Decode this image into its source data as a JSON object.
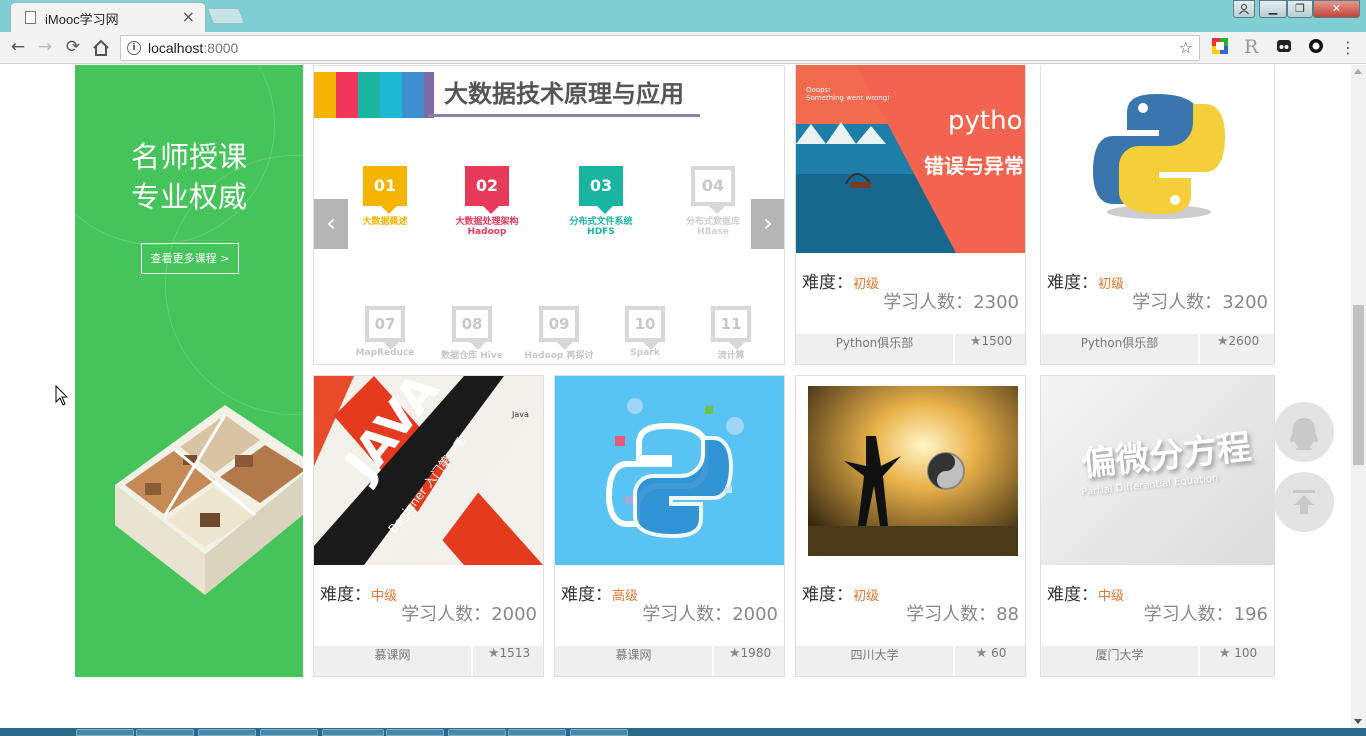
{
  "browser": {
    "tab_title": "iMooc学习网",
    "tab_close": "×",
    "url_host": "localhost",
    "url_port": ":8000",
    "ext_r": "R"
  },
  "promo": {
    "line1": "名师授课",
    "line2": "专业权威",
    "button": "查看更多课程 >"
  },
  "banner": {
    "title": "大数据技术原理与应用",
    "modules": [
      {
        "num": "01",
        "label": "大数据概述",
        "sub": "",
        "color": "#f5b400"
      },
      {
        "num": "02",
        "label": "大数据处理架构",
        "sub": "Hadoop",
        "color": "#e83a5b"
      },
      {
        "num": "03",
        "label": "分布式文件系统",
        "sub": "HDFS",
        "color": "#1ab5a0"
      },
      {
        "num": "04",
        "label": "分布式数据库",
        "sub": "HBase",
        "color": "#d0d0d0"
      }
    ],
    "modules_small": [
      {
        "num": "07",
        "label": "MapReduce"
      },
      {
        "num": "08",
        "label": "数据仓库 Hive"
      },
      {
        "num": "09",
        "label": "Hadoop 再探讨"
      },
      {
        "num": "10",
        "label": "Spark"
      },
      {
        "num": "11",
        "label": "流计算"
      }
    ],
    "prev": "‹",
    "next": "›"
  },
  "thumbs": {
    "python_err_title": "python",
    "python_err_sub": "错误与异常",
    "python_err_note": "Ooops!\nSomething went wrong!",
    "java_title": "JAVA",
    "java_sub": "Beginner 入门第一季",
    "java_logo": "Java",
    "pde_title": "偏微分方程",
    "pde_sub": "Partial Differential Equation"
  },
  "labels": {
    "level": "难度：",
    "learners": "学习人数："
  },
  "courses": [
    {
      "level": "初级",
      "learners": "2300",
      "school": "Python俱乐部",
      "favs": "1500"
    },
    {
      "level": "初级",
      "learners": "3200",
      "school": "Python俱乐部",
      "favs": "2600"
    },
    {
      "level": "中级",
      "learners": "2000",
      "school": "慕课网",
      "favs": "1513"
    },
    {
      "level": "高级",
      "learners": "2000",
      "school": "慕课网",
      "favs": "1980"
    },
    {
      "level": "初级",
      "learners": "88",
      "school": "四川大学",
      "favs": " 60"
    },
    {
      "level": "中级",
      "learners": "196",
      "school": "厦门大学",
      "favs": " 100"
    }
  ]
}
